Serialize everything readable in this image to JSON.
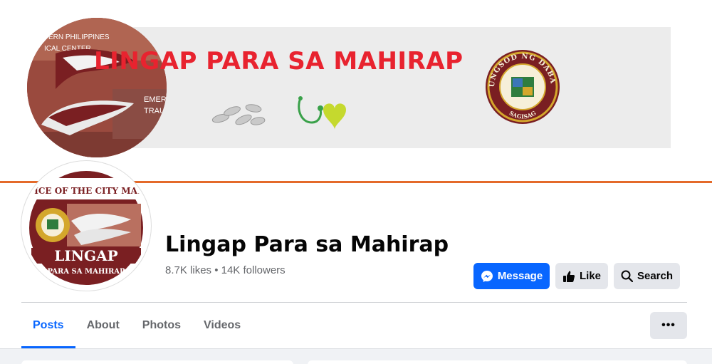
{
  "cover": {
    "banner_title": "LINGAP PARA SA MAHIRAP",
    "seal_text_top": "LUNGSOD NG DABAW",
    "seal_text_bottom": "SAGISAG",
    "photo_text_1": "ERN PHILIPPINES",
    "photo_text_2": "ICAL CENTER",
    "photo_text_3": "EMER",
    "photo_text_4": "TRAU"
  },
  "profile": {
    "pic_top_text": "OFFICE OF THE CITY MAYOR",
    "pic_main_text": "LINGAP",
    "pic_sub_text": "PARA SA MAHIRAP",
    "page_name": "Lingap Para sa Mahirap",
    "stats": "8.7K likes • 14K followers"
  },
  "actions": {
    "message_label": "Message",
    "like_label": "Like",
    "search_label": "Search",
    "more_label": "•••"
  },
  "tabs": [
    {
      "label": "Posts",
      "active": true
    },
    {
      "label": "About",
      "active": false
    },
    {
      "label": "Photos",
      "active": false
    },
    {
      "label": "Videos",
      "active": false
    }
  ],
  "colors": {
    "accent": "#0866ff",
    "banner_red": "#e8232f",
    "divider_orange": "#e46a2a",
    "maroon": "#7a1f22"
  },
  "icons": [
    "messenger-icon",
    "thumbs-up-icon",
    "search-icon",
    "more-dots-icon",
    "pills-icon",
    "stethoscope-heart-icon"
  ]
}
